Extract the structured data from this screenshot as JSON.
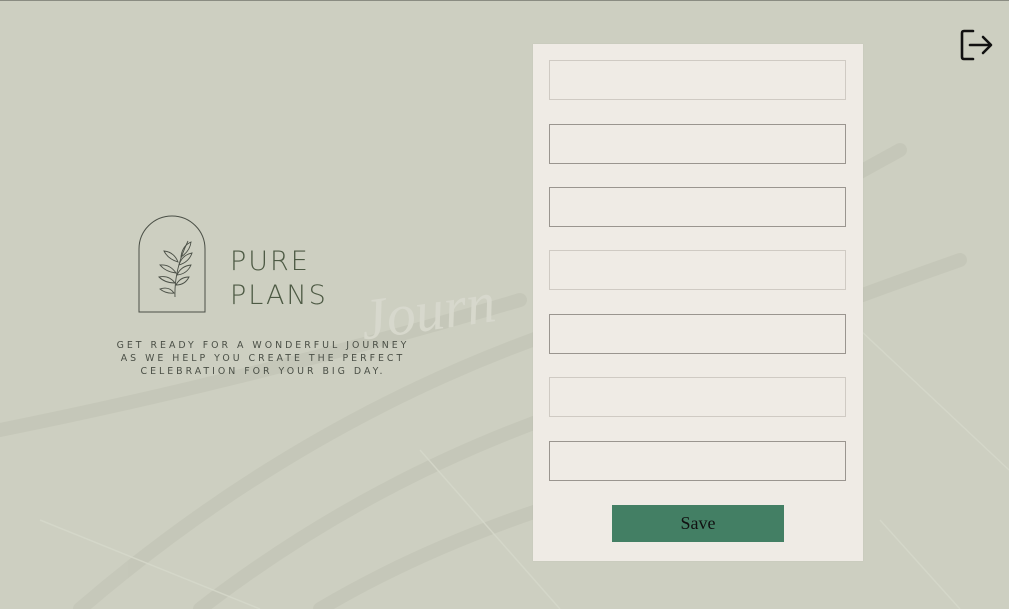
{
  "brand": {
    "name_line1": "PURE",
    "name_line2": "PLANS",
    "tagline": "GET READY FOR A WONDERFUL JOURNEY AS WE HELP YOU CREATE THE PERFECT CELEBRATION FOR YOUR BIG DAY.",
    "emblem_icon": "leaf-branch-arch-icon"
  },
  "header": {
    "logout_icon": "logout-icon"
  },
  "form": {
    "fields": [
      {
        "value": "",
        "placeholder": ""
      },
      {
        "value": "",
        "placeholder": ""
      },
      {
        "value": "",
        "placeholder": ""
      },
      {
        "value": "",
        "placeholder": ""
      },
      {
        "value": "",
        "placeholder": ""
      },
      {
        "value": "",
        "placeholder": ""
      },
      {
        "value": "",
        "placeholder": ""
      }
    ],
    "save_label": "Save"
  },
  "colors": {
    "background": "#cdcfc1",
    "panel": "#efebe5",
    "accent": "#437f64",
    "brand_text": "#4d5a44"
  }
}
